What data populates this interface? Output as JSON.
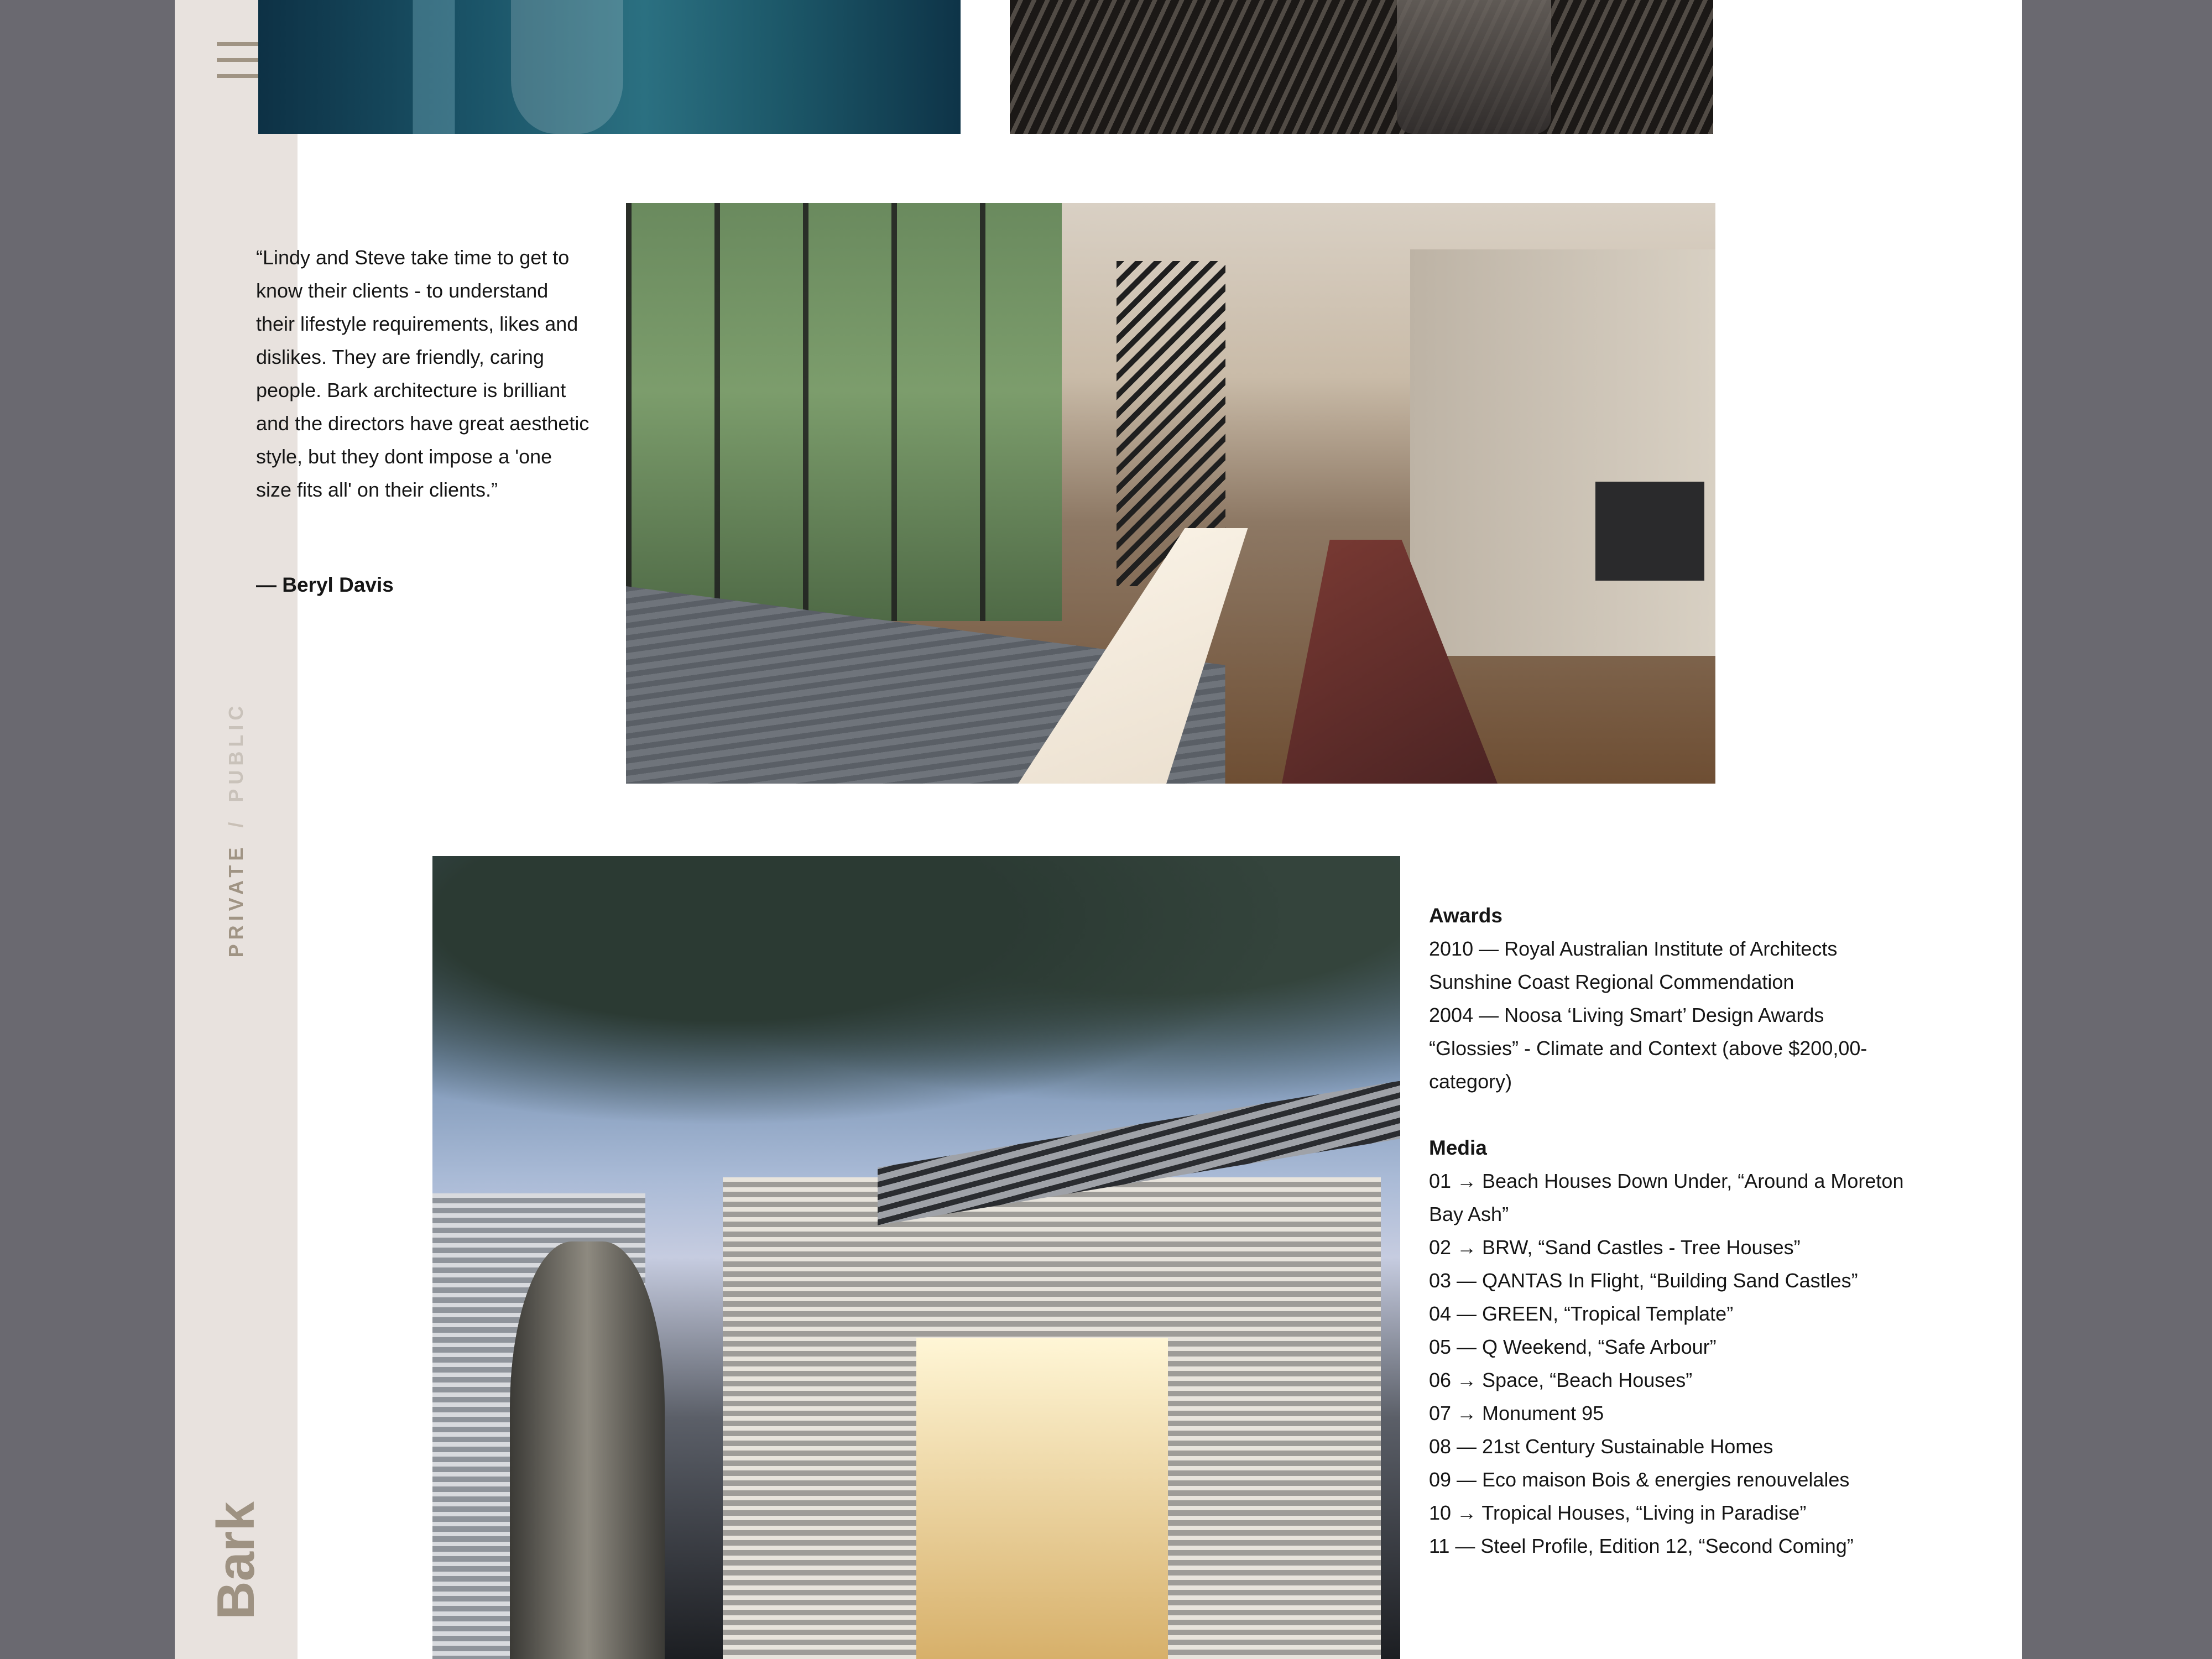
{
  "sidebar": {
    "menu_icon": "hamburger-menu-icon",
    "filter_private": "PRIVATE",
    "filter_separator": "/",
    "filter_public": "PUBLIC",
    "logo_text": "Bark",
    "colors": {
      "accent": "#a09484",
      "background": "#e8e2de"
    }
  },
  "testimonial": {
    "quote": "“Lindy and Steve take time to get to know their clients - to understand their lifestyle requirements, likes and dislikes. They are friendly, caring people. Bark architecture is brilliant and the directors have great aesthetic style, but they dont impose a 'one size fits all' on their clients.”",
    "author": "— Beryl Davis"
  },
  "awards": {
    "heading": "Awards",
    "items": [
      "2010 — Royal Australian Institute of Architects Sunshine Coast Regional Commendation",
      "2004 — Noosa ‘Living Smart’ Design Awards “Glossies” - Climate and Context (above $200,00- category)"
    ]
  },
  "media": {
    "heading": "Media",
    "items": [
      "01 → Beach Houses Down Under, “Around a Moreton Bay Ash”",
      "02 → BRW, “Sand Castles - Tree Houses”",
      "03 — QANTAS In Flight, “Building Sand Castles”",
      "04 — GREEN, “Tropical Template”",
      "05 — Q Weekend, “Safe Arbour”",
      "06 → Space, “Beach Houses”",
      "07 → Monument 95",
      "08 — 21st Century Sustainable Homes",
      "09 — Eco maison Bois & energies renouvelales",
      "10 → Tropical Houses, “Living in Paradise”",
      "11 — Steel Profile, Edition 12, “Second Coming”"
    ]
  }
}
